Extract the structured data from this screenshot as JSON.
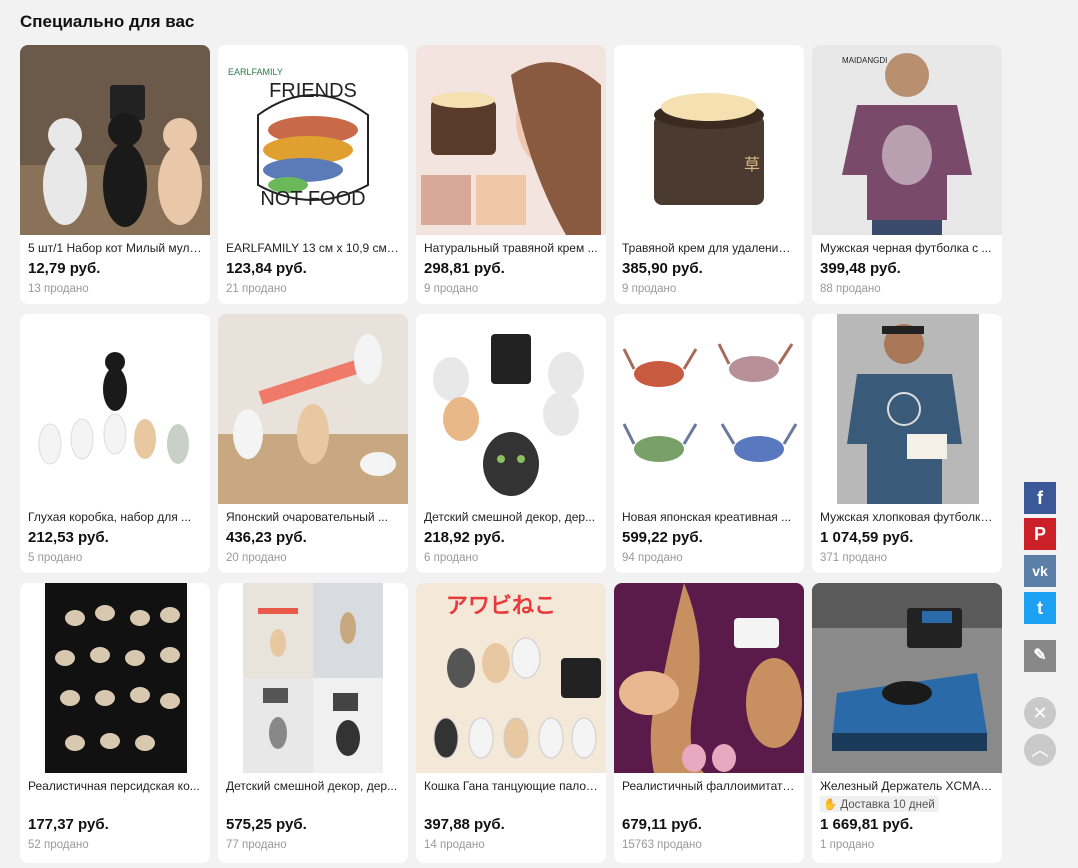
{
  "section": {
    "title": "Специально для вас"
  },
  "products": [
    {
      "title": "5 шт/1 Набор кот Милый мульт...",
      "price": "12,79 руб.",
      "sold": "13 продано",
      "colors": [
        "#5a4a3a",
        "#d8d2c8"
      ]
    },
    {
      "title": "EARLFAMILY 13 см x 10,9 см ...",
      "price": "123,84 руб.",
      "sold": "21 продано",
      "colors": [
        "#ffffff",
        "#c86a4a"
      ]
    },
    {
      "title": "Натуральный травяной крем ...",
      "price": "298,81 руб.",
      "sold": "9 продано",
      "colors": [
        "#e8c8c0",
        "#6a4a38"
      ]
    },
    {
      "title": "Травяной крем для удаления ...",
      "price": "385,90 руб.",
      "sold": "9 продано",
      "colors": [
        "#ffffff",
        "#4a3a30"
      ]
    },
    {
      "title": "Мужская черная футболка с ...",
      "price": "399,48 руб.",
      "sold": "88 продано",
      "colors": [
        "#e8e8e8",
        "#7a4a6a"
      ]
    },
    {
      "title": "Глухая коробка, набор для ...",
      "price": "212,53 руб.",
      "sold": "5 продано",
      "colors": [
        "#ffffff",
        "#c8a888"
      ]
    },
    {
      "title": "Японский очаровательный ...",
      "price": "436,23 руб.",
      "sold": "20 продано",
      "colors": [
        "#d8c4ac",
        "#e8e4de"
      ]
    },
    {
      "title": "Детский смешной декор, дер...",
      "price": "218,92 руб.",
      "sold": "6 продано",
      "colors": [
        "#ffffff",
        "#333333"
      ]
    },
    {
      "title": "Новая японская креативная ...",
      "price": "599,22 руб.",
      "sold": "94 продано",
      "colors": [
        "#ffffff",
        "#b86a6a"
      ]
    },
    {
      "title": "Мужская хлопковая футболка ...",
      "price": "1 074,59 руб.",
      "sold": "371 продано",
      "colors": [
        "#b8b8b8",
        "#3a5a7a"
      ]
    },
    {
      "title": "Реалистичная персидская ко...",
      "price": "177,37 руб.",
      "sold": "52 продано",
      "colors": [
        "#111111",
        "#d8c8b0"
      ]
    },
    {
      "title": "Детский смешной декор, дер...",
      "price": "575,25 руб.",
      "sold": "77 продано",
      "colors": [
        "#e8e8e8",
        "#c8a888"
      ]
    },
    {
      "title": "Кошка Гана танцующие палоч...",
      "price": "397,88 руб.",
      "sold": "14 продано",
      "colors": [
        "#f4e8d8",
        "#e83a3a"
      ]
    },
    {
      "title": "Реалистичный фаллоимитатор ...",
      "price": "679,11 руб.",
      "sold": "15763 продано",
      "colors": [
        "#5a1a4a",
        "#c89060"
      ]
    },
    {
      "title": "Железный Держатель XCMAN ...",
      "price": "1 669,81 руб.",
      "sold": "1 продано",
      "delivery": "Доставка 10 дней",
      "colors": [
        "#8a8a8a",
        "#2a6aa8"
      ]
    }
  ],
  "social": {
    "fb": "f",
    "pin": "P",
    "vk": "vk",
    "tw": "t",
    "edit": "✎"
  },
  "controls": {
    "close": "✕",
    "up": "︿"
  }
}
